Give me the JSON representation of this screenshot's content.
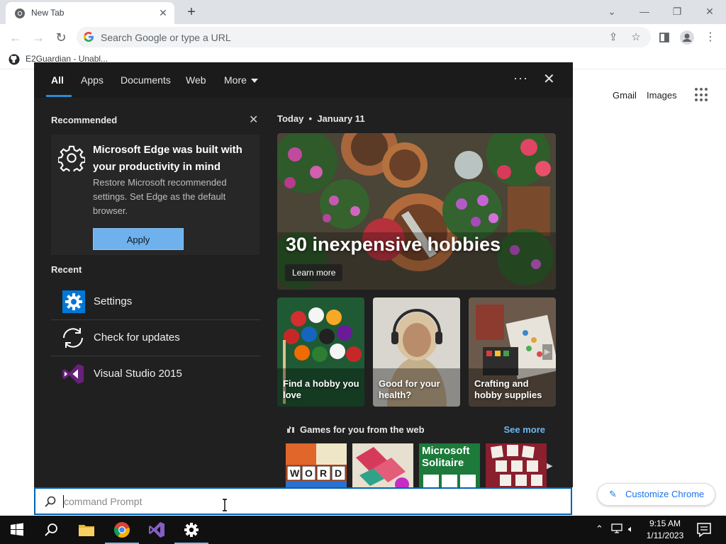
{
  "browser": {
    "tab_title": "New Tab",
    "tab_close": "✕",
    "new_tab": "+",
    "omnibox_placeholder": "Search Google or type a URL",
    "bookmark": "E2Guardian - Unabl...",
    "ntp_links": [
      "Gmail",
      "Images"
    ],
    "customize_label": "Customize Chrome"
  },
  "panel": {
    "tabs": [
      "All",
      "Apps",
      "Documents",
      "Web",
      "More"
    ],
    "active_tab": "All",
    "more_menu": "···",
    "recommended": {
      "title": "Recommended",
      "card_title": "Microsoft Edge was built with your productivity in mind",
      "card_body": "Restore Microsoft recommended settings. Set Edge as the default browser.",
      "button": "Apply"
    },
    "recent": {
      "title": "Recent",
      "items": [
        "Settings",
        "Check for updates",
        "Visual Studio 2015"
      ]
    },
    "today": {
      "label": "Today",
      "date": "January 11",
      "hero_title": "30 inexpensive hobbies",
      "hero_button": "Learn more",
      "tiles": [
        "Find a hobby you love",
        "Good for your health?",
        "Crafting and hobby supplies"
      ]
    },
    "games": {
      "title": "Games for you from the web",
      "see_more": "See more",
      "solitaire_label": "Microsoft Solitaire",
      "word_letters": [
        "W",
        "O",
        "R",
        "D"
      ]
    }
  },
  "search": {
    "value": "",
    "placeholder": "command Prompt"
  },
  "taskbar": {
    "time": "9:15 AM",
    "date": "1/11/2023",
    "accent": "#76b9ed"
  }
}
